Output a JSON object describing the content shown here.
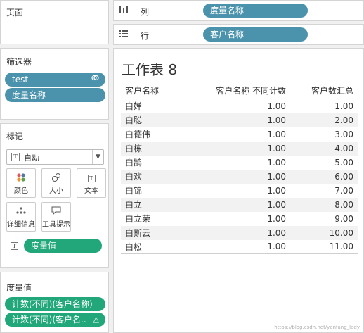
{
  "pages": {
    "title": "页面"
  },
  "columns_shelf": {
    "label": "列",
    "icon": "columns-icon",
    "pill": "度量名称"
  },
  "rows_shelf": {
    "label": "行",
    "icon": "rows-icon",
    "pill": "客户名称"
  },
  "filters": {
    "title": "筛选器",
    "items": [
      {
        "label": "test",
        "icon": "link-icon"
      },
      {
        "label": "度量名称"
      }
    ]
  },
  "marks": {
    "title": "标记",
    "mark_type": "自动",
    "buttons": [
      {
        "label": "颜色",
        "icon": "color-icon"
      },
      {
        "label": "大小",
        "icon": "size-icon"
      },
      {
        "label": "文本",
        "icon": "text-icon"
      },
      {
        "label": "详细信息",
        "icon": "detail-icon"
      },
      {
        "label": "工具提示",
        "icon": "tooltip-icon"
      }
    ],
    "text_pill": "度量值"
  },
  "measure_values": {
    "title": "度量值",
    "items": [
      {
        "label": "计数(不同)(客户名称)"
      },
      {
        "label": "计数(不同)(客户名..",
        "trail": "△"
      }
    ]
  },
  "sheet": {
    "title": "工作表 8",
    "headers": [
      "客户名称",
      "客户名称 不同计数",
      "客户数汇总"
    ],
    "rows": [
      [
        "白婵",
        "1.00",
        "1.00"
      ],
      [
        "白聪",
        "1.00",
        "2.00"
      ],
      [
        "白德伟",
        "1.00",
        "3.00"
      ],
      [
        "白栋",
        "1.00",
        "4.00"
      ],
      [
        "白鹄",
        "1.00",
        "5.00"
      ],
      [
        "白欢",
        "1.00",
        "6.00"
      ],
      [
        "白锦",
        "1.00",
        "7.00"
      ],
      [
        "白立",
        "1.00",
        "8.00"
      ],
      [
        "白立荣",
        "1.00",
        "9.00"
      ],
      [
        "白斯云",
        "1.00",
        "10.00"
      ],
      [
        "白松",
        "1.00",
        "11.00"
      ]
    ]
  },
  "watermark": "https://blog.csdn.net/yanfang_lady",
  "colors": {
    "dimension_pill": "#4b93ac",
    "measure_pill": "#22a77a"
  }
}
